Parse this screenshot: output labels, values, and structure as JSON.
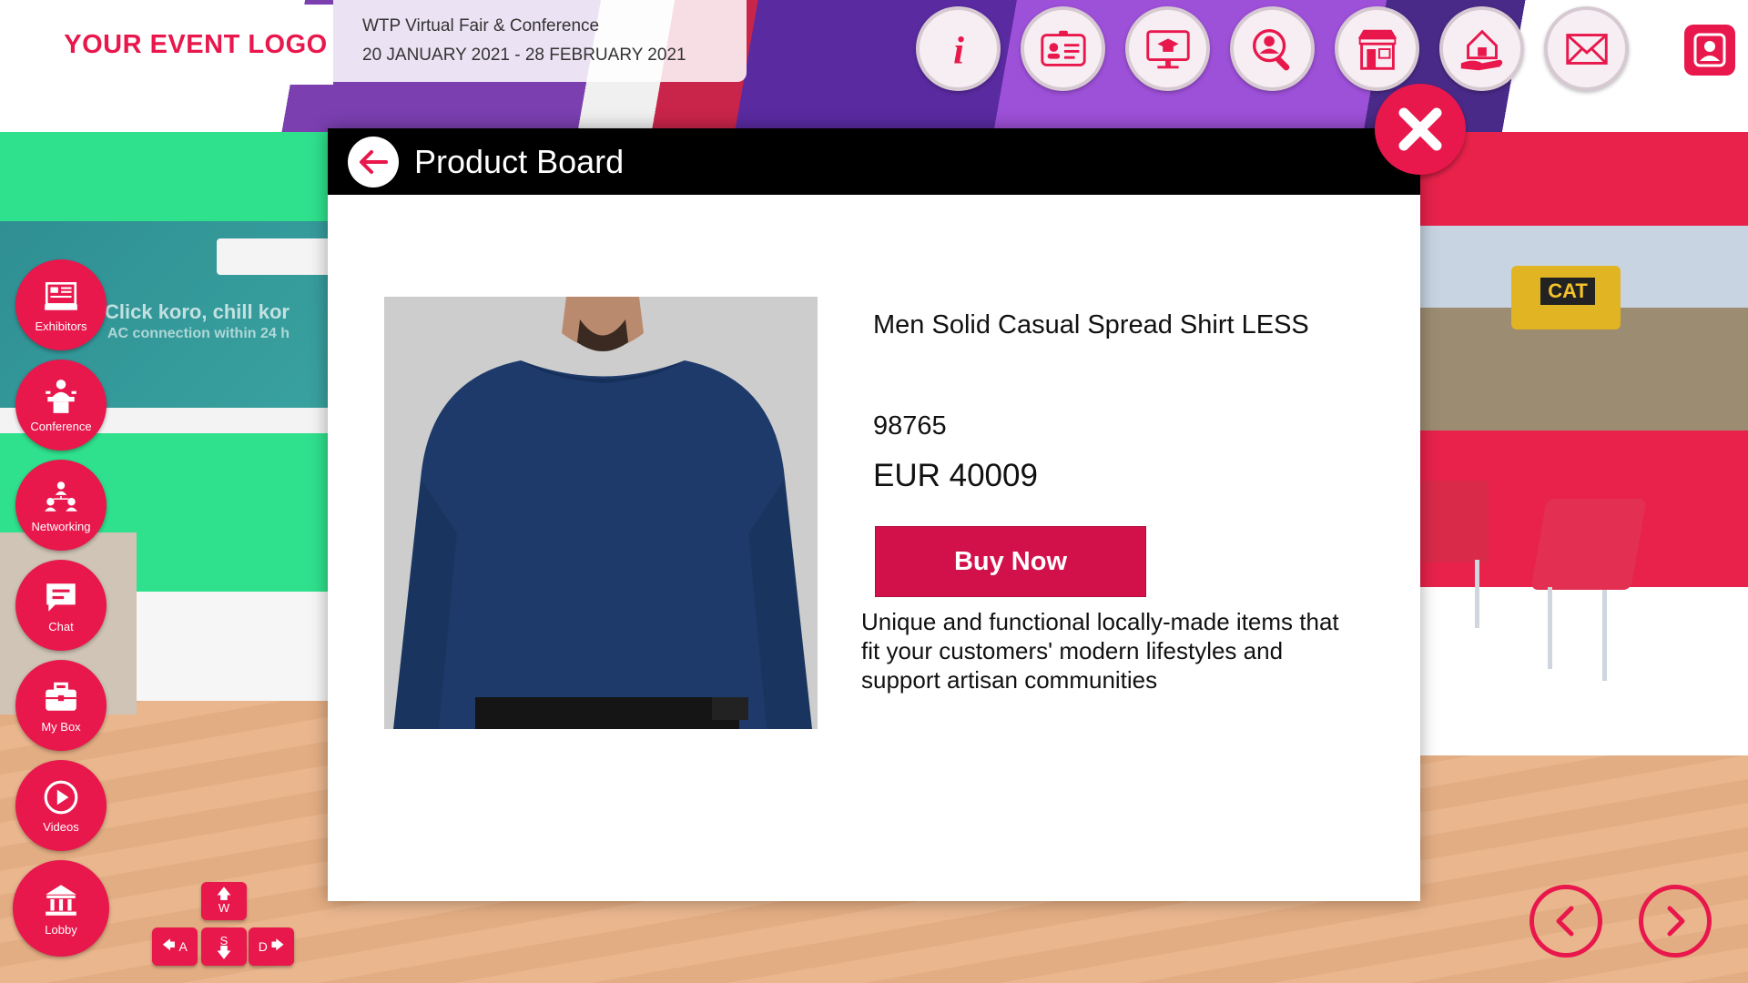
{
  "event": {
    "logo_text": "YOUR EVENT LOGO",
    "name": "WTP Virtual Fair & Conference",
    "dates": "20 JANUARY 2021 - 28 FEBRUARY 2021"
  },
  "toolbar": {
    "icons": [
      "info-icon",
      "id-card-icon",
      "presentation-icon",
      "search-person-icon",
      "booth-icon",
      "home-hand-icon",
      "mail-icon",
      "profile-icon"
    ]
  },
  "side_nav": {
    "items": [
      {
        "label": "Exhibitors",
        "icon": "exhibitors-icon"
      },
      {
        "label": "Conference",
        "icon": "conference-icon"
      },
      {
        "label": "Networking",
        "icon": "networking-icon"
      },
      {
        "label": "Chat",
        "icon": "chat-icon"
      },
      {
        "label": "My Box",
        "icon": "briefcase-icon"
      },
      {
        "label": "Videos",
        "icon": "play-icon"
      },
      {
        "label": "Lobby",
        "icon": "lobby-icon"
      }
    ]
  },
  "keys": {
    "w": "W",
    "a": "A",
    "s": "S",
    "d": "D"
  },
  "scene": {
    "left_banner_line1": "Click koro, chill kor",
    "left_banner_line2": "AC connection within 24 h",
    "cat_label": "CAT"
  },
  "modal": {
    "title": "Product Board",
    "product": {
      "name": "Men Solid Casual Spread Shirt LESS",
      "id": "98765",
      "price": "EUR 40009",
      "buy_label": "Buy Now",
      "description": "Unique and functional locally-made items that fit your customers' modern lifestyles and support artisan communities"
    }
  },
  "colors": {
    "accent": "#e8174c",
    "buy": "#d2104a",
    "header": "#000000"
  }
}
